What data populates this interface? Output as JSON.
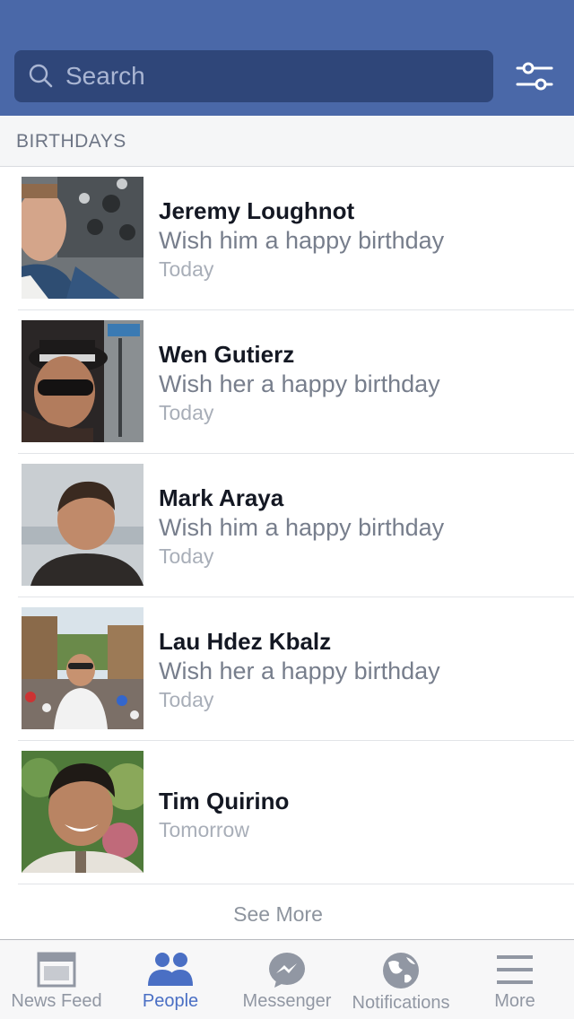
{
  "search": {
    "placeholder": "Search"
  },
  "section": {
    "title": "BIRTHDAYS"
  },
  "birthdays": [
    {
      "name": "Jeremy Loughnot",
      "wish": "Wish him a happy birthday",
      "when": "Today"
    },
    {
      "name": "Wen Gutierz",
      "wish": "Wish her a happy birthday",
      "when": "Today"
    },
    {
      "name": "Mark Araya",
      "wish": "Wish him a happy birthday",
      "when": "Today"
    },
    {
      "name": "Lau Hdez Kbalz",
      "wish": "Wish her a happy birthday",
      "when": "Today"
    },
    {
      "name": "Tim Quirino",
      "when": "Tomorrow"
    }
  ],
  "see_more": "See More",
  "tabs": [
    {
      "label": "News Feed",
      "icon": "news-feed-icon"
    },
    {
      "label": "People",
      "icon": "people-icon",
      "active": true
    },
    {
      "label": "Messenger",
      "icon": "messenger-icon"
    },
    {
      "label": "Notifications",
      "icon": "globe-icon"
    },
    {
      "label": "More",
      "icon": "menu-icon"
    }
  ],
  "colors": {
    "header": "#4a68a8",
    "search_bar": "#2f4679",
    "active_tab": "#4a6fc4",
    "inactive_tab": "#9197a3"
  }
}
